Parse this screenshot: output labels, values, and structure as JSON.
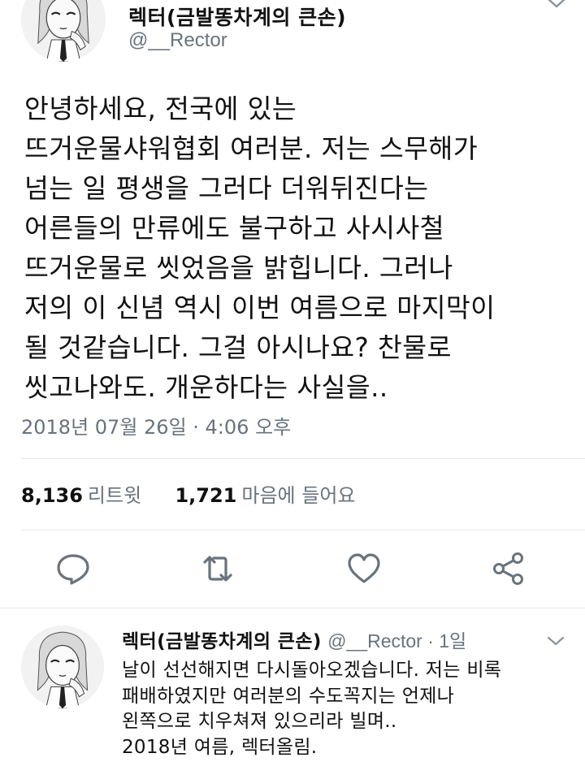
{
  "tweet": {
    "author_name": "렉터(금발똥차계의 큰손)",
    "handle": "@__Rector",
    "body_lines": [
      "안녕하세요, 전국에 있는",
      "뜨거운물샤워협회 여러분. 저는 스무해가",
      "넘는 일 평생을 그러다 더워뒤진다는",
      "어른들의 만류에도 불구하고 사시사철",
      "뜨거운물로 씻었음을 밝힙니다. 그러나",
      "저의 이 신념 역시 이번 여름으로 마지막이",
      "될 것같습니다. 그걸 아시나요? 찬물로",
      "씻고나와도. 개운하다는 사실을.."
    ],
    "timestamp": "2018년 07월 26일 · 4:06 오후",
    "retweet_count": "8,136",
    "retweet_label": "리트윗",
    "like_count": "1,721",
    "like_label": "마음에 들어요"
  },
  "actions": {
    "reply_icon": "reply-icon",
    "retweet_icon": "retweet-icon",
    "like_icon": "heart-icon",
    "share_icon": "share-icon"
  },
  "reply": {
    "author_name": "렉터(금발똥차계의 큰손)",
    "meta": "@__Rector · 1일",
    "body_lines": [
      "날이 선선해지면 다시돌아오겠습니다. 저는 비록",
      "패배하였지만 여러분의 수도꼭지는 언제나",
      "왼쪽으로 치우쳐져 있으리라 빌며..",
      "2018년 여름, 렉터올림."
    ]
  },
  "colors": {
    "text": "#111111",
    "muted": "#68737d",
    "divider": "#e4e8eb",
    "icon": "#68737d"
  }
}
